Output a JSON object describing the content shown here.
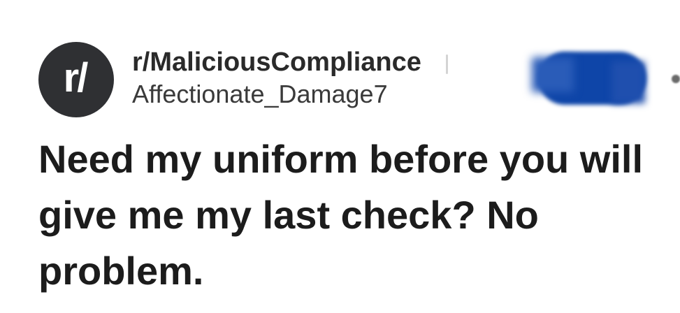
{
  "post": {
    "subreddit": "r/MaliciousCompliance",
    "author": "Affectionate_Damage7",
    "avatar_text": "r/",
    "title": "Need my uniform before you will give me my last check? No problem."
  },
  "icons": {
    "avatar": "subreddit-avatar-icon",
    "more": "more-options-icon"
  },
  "colors": {
    "avatar_bg": "#2f3033",
    "join_button": "#0e45a8",
    "title_text": "#1c1c1c"
  }
}
